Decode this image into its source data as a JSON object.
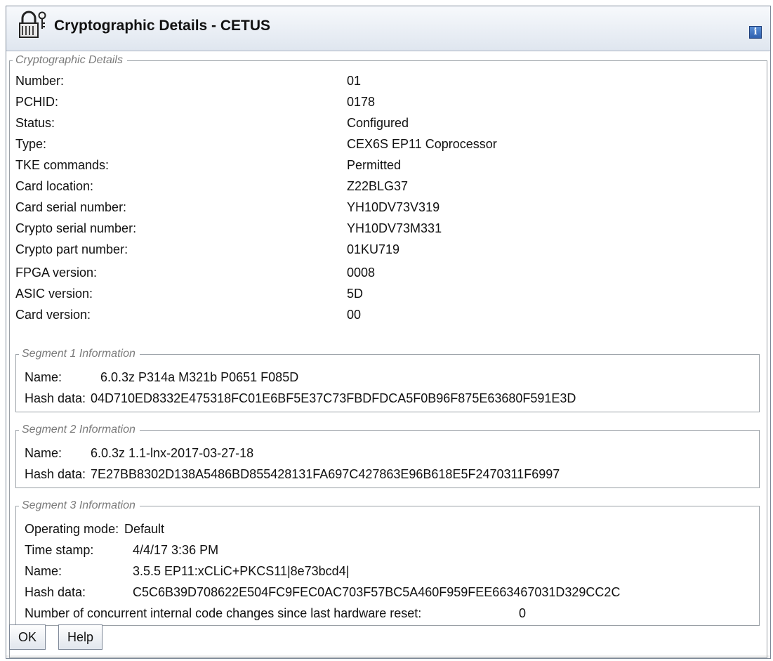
{
  "window": {
    "title": "Cryptographic Details - CETUS"
  },
  "icons": {
    "title": "padlock-key-icon",
    "info": "info-icon"
  },
  "info_button": {
    "label": "i"
  },
  "details": {
    "legend": "Cryptographic Details",
    "rows": [
      {
        "label": "Number:",
        "value": "01"
      },
      {
        "label": "PCHID:",
        "value": "0178"
      },
      {
        "label": "Status:",
        "value": "Configured"
      },
      {
        "label": "Type:",
        "value": "CEX6S EP11 Coprocessor"
      },
      {
        "label": "TKE commands:",
        "value": "Permitted"
      },
      {
        "label": "Card location:",
        "value": "Z22BLG37"
      },
      {
        "label": "Card serial number:",
        "value": "YH10DV73V319"
      },
      {
        "label": "Crypto serial number:",
        "value": "YH10DV73M331"
      },
      {
        "label": "Crypto part number:",
        "value": "01KU719"
      },
      {
        "label": "FPGA version:",
        "value": "0008"
      },
      {
        "label": "ASIC version:",
        "value": "5D"
      },
      {
        "label": "Card version:",
        "value": "00"
      }
    ]
  },
  "segment1": {
    "legend": "Segment 1 Information",
    "name_label": "Name:",
    "name_value": "6.0.3z P314a M321b P0651 F085D",
    "hash_label": "Hash data:",
    "hash_value": "04D710ED8332E475318FC01E6BF5E37C73FBDFDCA5F0B96F875E63680F591E3D"
  },
  "segment2": {
    "legend": "Segment 2 Information",
    "name_label": "Name:",
    "name_value": "6.0.3z 1.1-lnx-2017-03-27-18",
    "hash_label": "Hash data:",
    "hash_value": "7E27BB8302D138A5486BD855428131FA697C427863E96B618E5F2470311F6997"
  },
  "segment3": {
    "legend": "Segment 3 Information",
    "mode_label": "Operating mode:",
    "mode_value": "Default",
    "time_label": "Time stamp:",
    "time_value": "4/4/17 3:36 PM",
    "name_label": "Name:",
    "name_value": "3.5.5 EP11:xCLiC+PKCS11|8e73bcd4|",
    "hash_label": "Hash data:",
    "hash_value": "C5C6B39D708622E504FC9FEC0AC703F57BC5A460F959FEE663467031D329CC2C",
    "changes_label": "Number of concurrent internal code changes since last hardware reset:",
    "changes_value": "0"
  },
  "buttons": {
    "ok": "OK",
    "help": "Help"
  }
}
